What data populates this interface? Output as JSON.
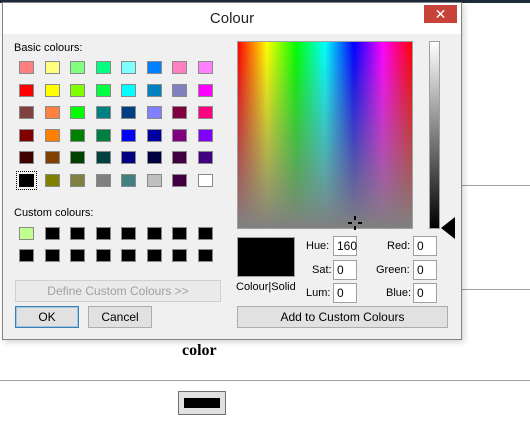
{
  "dialog": {
    "title": "Colour",
    "close_symbol": "✕",
    "basic_colours_label": "Basic colours:",
    "custom_colours_label": "Custom colours:",
    "define_button": "Define Custom Colours >>",
    "ok_button": "OK",
    "cancel_button": "Cancel",
    "add_button": "Add to Custom Colours",
    "preview_label": "Colour|Solid",
    "fields": {
      "hue": {
        "label": "Hue:",
        "value": "160"
      },
      "sat": {
        "label": "Sat:",
        "value": "0"
      },
      "lum": {
        "label": "Lum:",
        "value": "0"
      },
      "red": {
        "label": "Red:",
        "value": "0"
      },
      "green": {
        "label": "Green:",
        "value": "0"
      },
      "blue": {
        "label": "Blue:",
        "value": "0"
      }
    },
    "basic_colours": [
      [
        "#ff8080",
        "#ffff80",
        "#80ff80",
        "#00ff80",
        "#80ffff",
        "#0080ff",
        "#ff80c0",
        "#ff80ff"
      ],
      [
        "#ff0000",
        "#ffff00",
        "#80ff00",
        "#00ff40",
        "#00ffff",
        "#0080c0",
        "#8080c0",
        "#ff00ff"
      ],
      [
        "#804040",
        "#ff8040",
        "#00ff00",
        "#008080",
        "#004080",
        "#8080ff",
        "#800040",
        "#ff0080"
      ],
      [
        "#800000",
        "#ff8000",
        "#008000",
        "#008040",
        "#0000ff",
        "#0000a0",
        "#800080",
        "#8000ff"
      ],
      [
        "#400000",
        "#804000",
        "#004000",
        "#004040",
        "#000080",
        "#000040",
        "#400040",
        "#400080"
      ],
      [
        "#000000",
        "#808000",
        "#808040",
        "#808080",
        "#408080",
        "#c0c0c0",
        "#400040",
        "#ffffff"
      ]
    ],
    "selected_basic": [
      5,
      0
    ],
    "custom_colours": [
      [
        "#c0ff90",
        "#000000",
        "#000000",
        "#000000",
        "#000000",
        "#000000",
        "#000000",
        "#000000"
      ],
      [
        "#000000",
        "#000000",
        "#000000",
        "#000000",
        "#000000",
        "#000000",
        "#000000",
        "#000000"
      ]
    ]
  },
  "page": {
    "heading": "color"
  },
  "icons": {
    "close": "close-icon",
    "crosshair": "crosshair-icon",
    "lum_arrow": "triangle-left-icon"
  }
}
